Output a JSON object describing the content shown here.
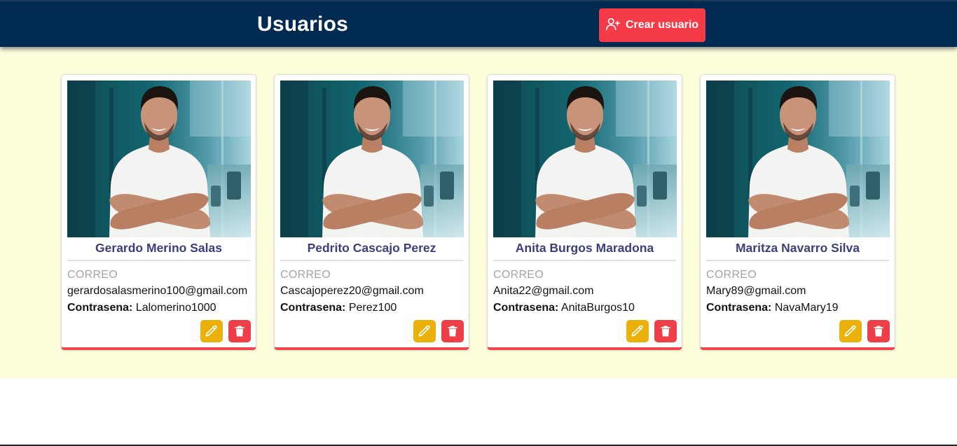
{
  "header": {
    "title": "Usuarios",
    "create_button_label": "Crear usuario",
    "create_button_icon": "user-plus-icon"
  },
  "colors": {
    "header_bg": "#012a52",
    "accent_red": "#f53b47",
    "edit_yellow": "#ebb10a",
    "page_bg": "#fdfddc",
    "name_color": "#3b3f7c"
  },
  "users": [
    {
      "name": "Gerardo Merino Salas",
      "correo_label": "CORREO",
      "email": "gerardosalasmerino100@gmail.com",
      "password_label": "Contrasena:",
      "password": "Lalomerino1000"
    },
    {
      "name": "Pedrito Cascajo Perez",
      "correo_label": "CORREO",
      "email": "Cascajoperez20@gmail.com",
      "password_label": "Contrasena:",
      "password": "Perez100"
    },
    {
      "name": "Anita Burgos Maradona",
      "correo_label": "CORREO",
      "email": "Anita22@gmail.com",
      "password_label": "Contrasena:",
      "password": "AnitaBurgos10"
    },
    {
      "name": "Maritza Navarro Silva",
      "correo_label": "CORREO",
      "email": "Mary89@gmail.com",
      "password_label": "Contrasena:",
      "password": "NavaMary19"
    }
  ]
}
